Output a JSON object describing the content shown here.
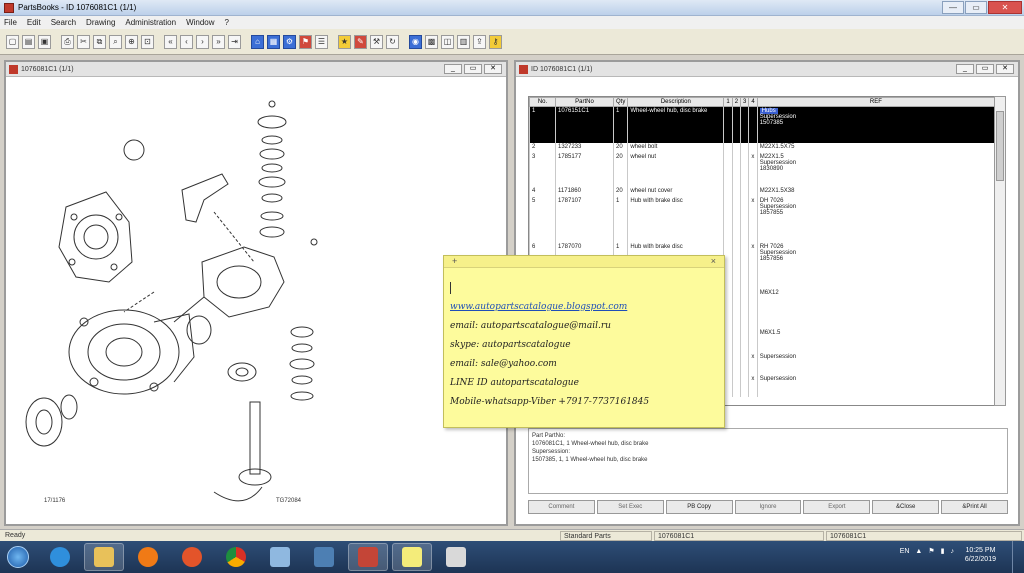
{
  "window": {
    "title": "PartsBooks - ID 1076081C1 (1/1)"
  },
  "menu": [
    "File",
    "Edit",
    "Search",
    "Drawing",
    "Administration",
    "Window",
    "?"
  ],
  "left_pane": {
    "title": "1076081C1 (1/1)",
    "diagram_code_left": "17/1176",
    "diagram_code_right": "TG72084"
  },
  "right_pane": {
    "title": "ID 1076081C1 (1/1)",
    "table": {
      "headers": [
        "No.",
        "PartNo",
        "Qty",
        "Description",
        "1",
        "2",
        "3",
        "4",
        "REF"
      ],
      "rows": [
        {
          "no": "1",
          "part": "1076151C1",
          "qty": "1",
          "desc": "Wheel-wheel hub, disc brake",
          "c4": "",
          "ref": "Hubs",
          "ref2": "Supersession",
          "ref3": "1507385",
          "selected": true
        },
        {
          "no": "2",
          "part": "1327233",
          "qty": "20",
          "desc": "wheel bolt",
          "c4": "",
          "ref": "M22X1.5X75",
          "ref2": "",
          "ref3": "",
          "selected": false
        },
        {
          "no": "3",
          "part": "1785177",
          "qty": "20",
          "desc": "wheel nut",
          "c4": "x",
          "ref": "M22X1.5",
          "ref2": "Supersession",
          "ref3": "1830890",
          "selected": false
        },
        {
          "no": "4",
          "part": "1171860",
          "qty": "20",
          "desc": "wheel nut cover",
          "c4": "",
          "ref": "M22X1.5X38",
          "ref2": "",
          "ref3": "",
          "selected": false
        },
        {
          "no": "5",
          "part": "1787107",
          "qty": "1",
          "desc": "Hub with brake disc",
          "c4": "x",
          "ref": "DH 7026",
          "ref2": "Supersession",
          "ref3": "1857855",
          "selected": false
        },
        {
          "no": "6",
          "part": "1787070",
          "qty": "1",
          "desc": "Hub with brake disc",
          "c4": "x",
          "ref": "RH 7026",
          "ref2": "Supersession",
          "ref3": "1857856",
          "selected": false
        }
      ],
      "lower_rows": [
        {
          "ref": "M6X12"
        },
        {
          "ref": "M6X1.5"
        },
        {
          "ref": "Supersession"
        },
        {
          "ref": "Supersession"
        }
      ]
    },
    "detail": {
      "line1": "Part PartNo:",
      "line2": "1076081C1, 1 Wheel-wheel hub, disc brake",
      "line3": "Supersession:",
      "line4": "1507385, 1, 1 Wheel-wheel hub, disc brake"
    },
    "buttons": [
      "Comment",
      "Set Exec",
      "PB Copy",
      "Ignore",
      "Export",
      "&Close",
      "&Print All"
    ]
  },
  "note": {
    "website": "www.autopartscatalogue.blogspot.com",
    "email1": "email: autopartscatalogue@mail.ru",
    "skype": "skype: autopartscatalogue",
    "email2": "email: sale@yahoo.com",
    "line": "LINE ID autopartscatalogue",
    "mobile": "Mobile-whatsapp-Viber +7917-7737161845"
  },
  "status": {
    "left": "Ready",
    "mid1": "Standard Parts",
    "mid2": "1076081C1",
    "right": "1076081C1"
  },
  "taskbar": {
    "lang": "EN",
    "time": "10:25 PM",
    "date": "6/22/2019"
  },
  "colors": {
    "selected_row": "#000000",
    "note_bg": "#fdfb9c",
    "link": "#1f4fb8",
    "taskbar": "#1d3454"
  }
}
